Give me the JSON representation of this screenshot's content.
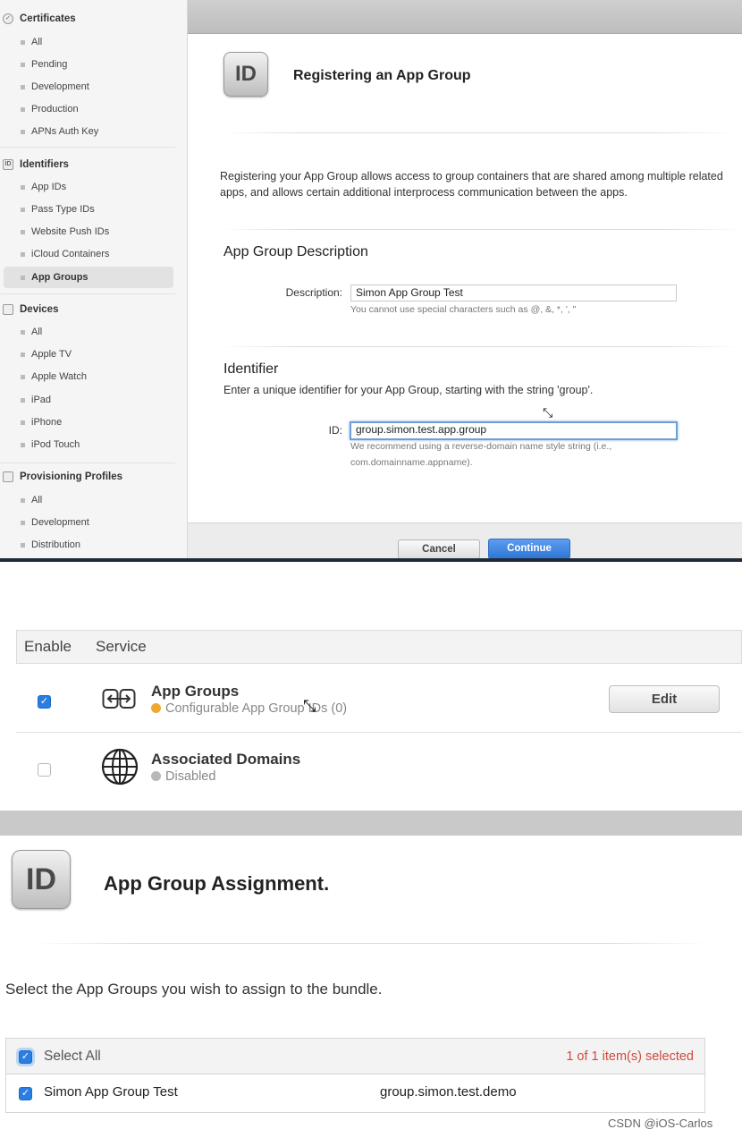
{
  "sidebar": {
    "certificates": {
      "heading": "Certificates",
      "items": [
        "All",
        "Pending",
        "Development",
        "Production",
        "APNs Auth Key"
      ]
    },
    "identifiers": {
      "heading": "Identifiers",
      "items": [
        "App IDs",
        "Pass Type IDs",
        "Website Push IDs",
        "iCloud Containers",
        "App Groups"
      ],
      "active": "App Groups"
    },
    "devices": {
      "heading": "Devices",
      "items": [
        "All",
        "Apple TV",
        "Apple Watch",
        "iPad",
        "iPhone",
        "iPod Touch"
      ]
    },
    "profiles": {
      "heading": "Provisioning Profiles",
      "items": [
        "All",
        "Development",
        "Distribution"
      ]
    }
  },
  "register": {
    "badge": "ID",
    "title": "Registering an App Group",
    "intro": "Registering your App Group allows access to group containers that are shared among multiple related apps, and allows certain additional interprocess communication between the apps.",
    "desc_heading": "App Group Description",
    "desc_label": "Description:",
    "desc_value": "Simon App Group Test",
    "desc_hint": "You cannot use special characters such as @, &, *, ', \"",
    "id_heading": "Identifier",
    "id_subtext": "Enter a unique identifier for your App Group, starting with the string 'group'.",
    "id_label": "ID:",
    "id_value": "group.simon.test.app.group",
    "id_hint_line1": "We recommend using a reverse-domain name style string (i.e.,",
    "id_hint_line2": "com.domainname.appname).",
    "cancel_label": "Cancel",
    "continue_label": "Continue"
  },
  "services": {
    "col_enable": "Enable",
    "col_service": "Service",
    "rows": [
      {
        "name": "App Groups",
        "status": "Configurable App Group IDs (0)",
        "checked": true,
        "status_color": "#f0a830",
        "icon": "app-groups-icon"
      },
      {
        "name": "Associated Domains",
        "status": "Disabled",
        "checked": false,
        "status_color": "#b8b8b8",
        "icon": "globe-icon"
      }
    ],
    "edit_label": "Edit"
  },
  "assignment": {
    "badge": "ID",
    "title": "App Group Assignment.",
    "intro": "Select the App Groups you wish to assign to the bundle.",
    "select_all": "Select All",
    "selected_count": "1 of 1 item(s) selected",
    "row_name": "Simon App Group Test",
    "row_id": "group.simon.test.demo"
  },
  "watermark": "CSDN @iOS-Carlos",
  "colors": {
    "accent_blue": "#2f77d6",
    "count_red": "#d24a3c"
  }
}
